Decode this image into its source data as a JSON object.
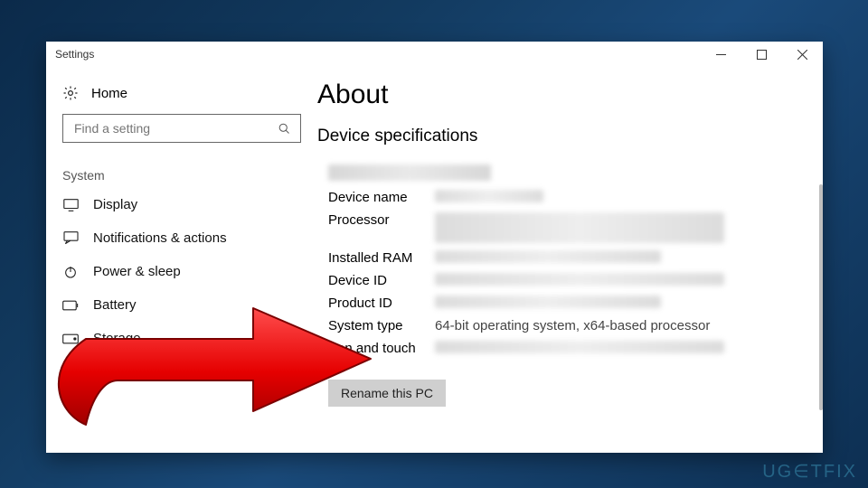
{
  "window": {
    "title": "Settings"
  },
  "sidebar": {
    "home": "Home",
    "search_placeholder": "Find a setting",
    "section": "System",
    "items": [
      {
        "label": "Display"
      },
      {
        "label": "Notifications & actions"
      },
      {
        "label": "Power & sleep"
      },
      {
        "label": "Battery"
      },
      {
        "label": "Storage"
      }
    ]
  },
  "content": {
    "title": "About",
    "section": "Device specifications",
    "specs": [
      {
        "label": "Device name",
        "value": "",
        "redacted": true
      },
      {
        "label": "Processor",
        "value": "",
        "redacted": true
      },
      {
        "label": "Installed RAM",
        "value": "",
        "redacted": true
      },
      {
        "label": "Device ID",
        "value": "",
        "redacted": true
      },
      {
        "label": "Product ID",
        "value": "",
        "redacted": true
      },
      {
        "label": "System type",
        "value": "64-bit operating system, x64-based processor",
        "redacted": false
      },
      {
        "label": "Pen and touch",
        "value": "",
        "redacted": true
      }
    ],
    "rename_button": "Rename this PC"
  },
  "watermark": "UGETFIX"
}
